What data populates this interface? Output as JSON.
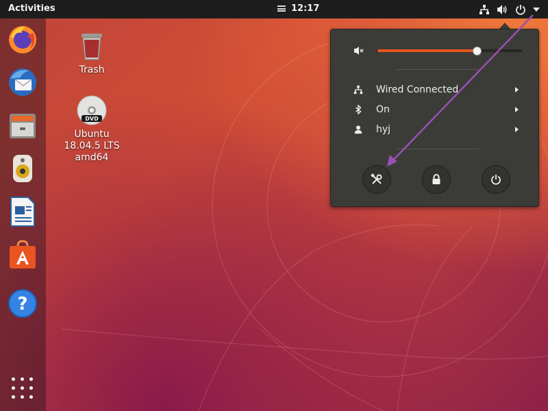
{
  "topbar": {
    "activities_label": "Activities",
    "clock": "12:17",
    "tray_icons": [
      "network-icon",
      "volume-icon",
      "power-icon",
      "chevron-down-icon"
    ]
  },
  "dock": {
    "items": [
      {
        "name": "Firefox",
        "icon": "firefox-icon"
      },
      {
        "name": "Thunderbird",
        "icon": "thunderbird-icon"
      },
      {
        "name": "Files",
        "icon": "files-icon"
      },
      {
        "name": "Rhythmbox",
        "icon": "rhythmbox-icon"
      },
      {
        "name": "LibreOffice Writer",
        "icon": "writer-icon"
      },
      {
        "name": "Ubuntu Software",
        "icon": "software-icon"
      },
      {
        "name": "Help",
        "icon": "help-icon"
      }
    ],
    "apps_grid_icon": "apps-grid-icon"
  },
  "desktop": {
    "icons": [
      {
        "label": "Trash",
        "icon": "trash-icon"
      },
      {
        "label": "Ubuntu\n18.04.5 LTS\namd64",
        "icon": "dvd-icon"
      }
    ]
  },
  "system_menu": {
    "volume": {
      "level": 0.69,
      "icon": "volume-low-icon"
    },
    "rows": [
      {
        "label": "Wired Connected",
        "icon": "network-icon"
      },
      {
        "label": "On",
        "icon": "bluetooth-icon"
      },
      {
        "label": "hyj",
        "icon": "user-icon"
      }
    ],
    "buttons": [
      {
        "name": "settings",
        "icon": "settings-tools-icon"
      },
      {
        "name": "lock",
        "icon": "lock-icon"
      },
      {
        "name": "power",
        "icon": "power-icon"
      }
    ]
  },
  "colors": {
    "accent": "#e95420",
    "menu_bg": "#3b3b37",
    "topbar_bg": "#1d1d1d",
    "annotation_arrow": "#9b4fb4"
  }
}
